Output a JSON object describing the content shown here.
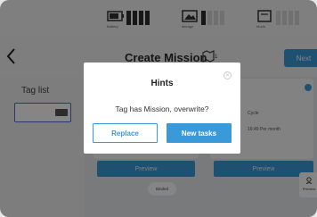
{
  "statusbar": {
    "groups": [
      {
        "icon": "battery-icon",
        "label": "Battery"
      },
      {
        "icon": "storage-icon",
        "label": "storage"
      },
      {
        "icon": "mode-icon",
        "label": "Mode"
      }
    ]
  },
  "header": {
    "title": "Create Mission",
    "map_suffix": "1",
    "next_label": "Next"
  },
  "left_panel": {
    "title": "Tag list"
  },
  "cards": {
    "field1_label": "Cycle",
    "field2_label": "16:49 Per month",
    "preview_label": "Preview"
  },
  "side_button": {
    "icon": "preview-icon",
    "label": "Preview"
  },
  "toast": "Binded",
  "dialog": {
    "title": "Hints",
    "message": "Tag has Mission, overwrite?",
    "replace_label": "Replace",
    "new_tasks_label": "New tasks"
  },
  "colors": {
    "accent": "#3a9ad9",
    "overlay": "rgba(0,0,0,0.48)"
  }
}
